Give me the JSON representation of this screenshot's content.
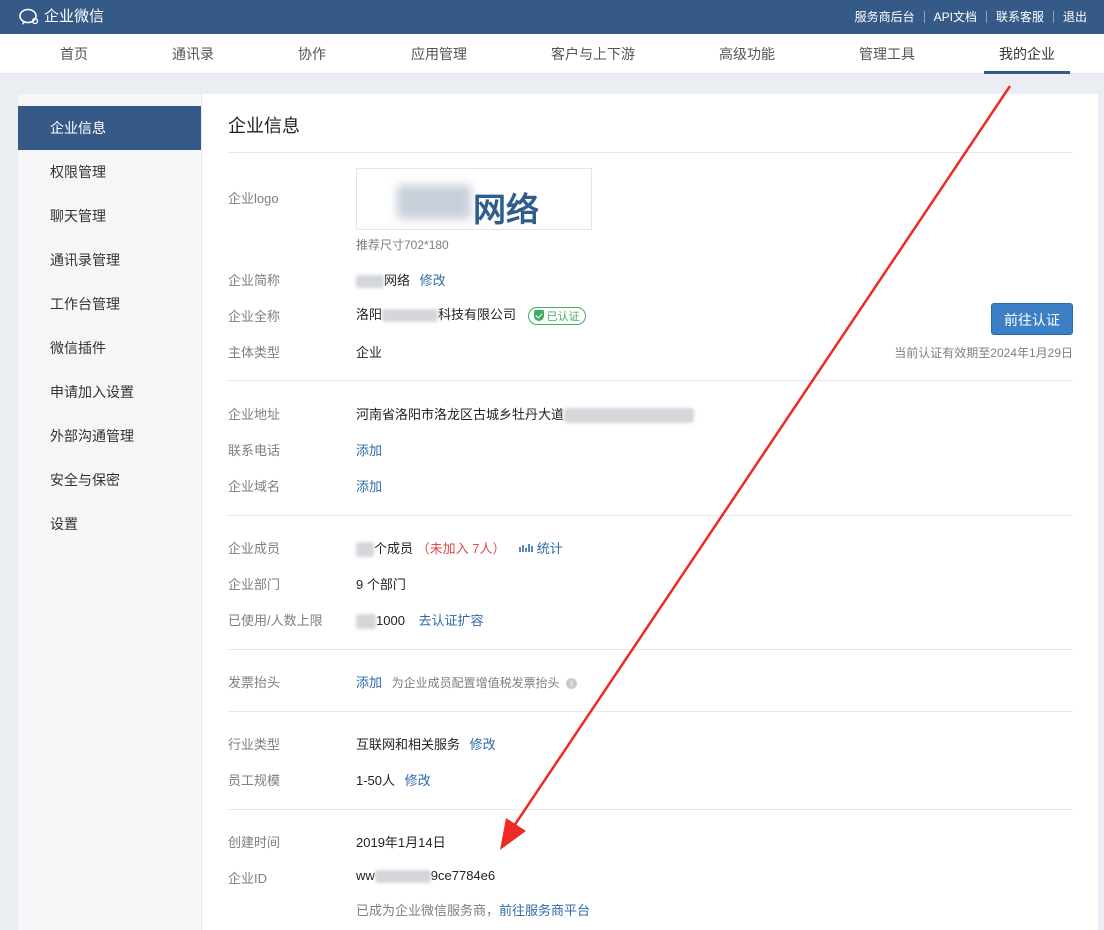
{
  "app": {
    "title": "企业微信"
  },
  "top_links": [
    "服务商后台",
    "API文档",
    "联系客服",
    "退出"
  ],
  "nav": {
    "tabs": [
      "首页",
      "通讯录",
      "协作",
      "应用管理",
      "客户与上下游",
      "高级功能",
      "管理工具",
      "我的企业"
    ],
    "active": "我的企业"
  },
  "sidebar": {
    "items": [
      "企业信息",
      "权限管理",
      "聊天管理",
      "通讯录管理",
      "工作台管理",
      "微信插件",
      "申请加入设置",
      "外部沟通管理",
      "安全与保密",
      "设置"
    ]
  },
  "page": {
    "title": "企业信息",
    "logo_label": "企业logo",
    "logo_text": "网络",
    "logo_hint": "推荐尺寸702*180",
    "short_name_label": "企业简称",
    "short_name_suffix": "网络",
    "edit": "修改",
    "full_name_label": "企业全称",
    "full_name_prefix": "洛阳",
    "full_name_suffix": "科技有限公司",
    "verified_badge": "已认证",
    "auth_button": "前往认证",
    "auth_note": "当前认证有效期至2024年1月29日",
    "type_label": "主体类型",
    "type_value": "企业",
    "address_label": "企业地址",
    "address_value": "河南省洛阳市洛龙区古城乡牡丹大道",
    "phone_label": "联系电话",
    "add": "添加",
    "domain_label": "企业域名",
    "members_label": "企业成员",
    "members_value": "个成员",
    "members_unjoined": "（未加入 7人）",
    "stats_link": "统计",
    "dept_label": "企业部门",
    "dept_value": "9 个部门",
    "limit_label": "已使用/人数上限",
    "limit_value": "1000",
    "expand_link": "去认证扩容",
    "invoice_label": "发票抬头",
    "invoice_hint": "为企业成员配置增值税发票抬头",
    "industry_label": "行业类型",
    "industry_value": "互联网和相关服务",
    "scale_label": "员工规模",
    "scale_value": "1-50人",
    "created_label": "创建时间",
    "created_value": "2019年1月14日",
    "id_label": "企业ID",
    "id_prefix": "ww",
    "id_suffix": "9ce7784e6",
    "provider_note": "已成为企业微信服务商，",
    "provider_link": "前往服务商平台"
  },
  "colors": {
    "header": "#365a87",
    "link": "#2f6aa8",
    "arrow": "#ee2a24",
    "verified": "#3fae62"
  }
}
